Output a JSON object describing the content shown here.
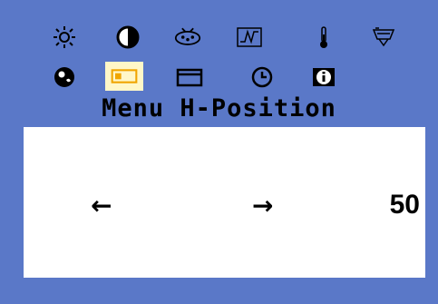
{
  "menu": {
    "title": "Menu H-Position",
    "value": "50",
    "left_arrow": "←",
    "right_arrow": "→"
  },
  "icons": {
    "row1": [
      "brightness-icon",
      "contrast-icon",
      "auto-adjust-icon",
      "waveform-icon",
      "thermometer-icon",
      "color-icon"
    ],
    "row2": [
      "language-icon",
      "osd-position-icon",
      "window-position-icon",
      "timer-icon",
      "information-icon"
    ],
    "selected": "osd-position-icon"
  },
  "colors": {
    "background": "#5a78c8",
    "panel": "#ffffff",
    "icon_fg": "#000000",
    "selected_icon": "#f0a500",
    "selected_bg": "#fff7c8"
  }
}
